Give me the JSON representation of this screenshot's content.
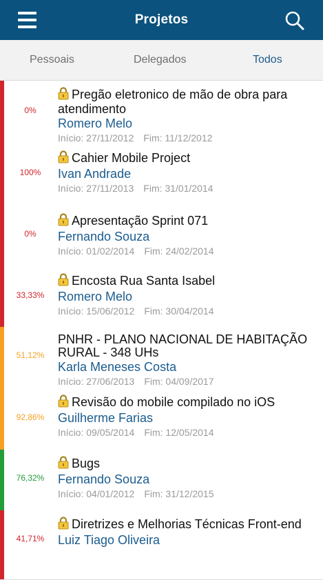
{
  "app": {
    "title": "Projetos"
  },
  "tabs": [
    {
      "label": "Pessoais"
    },
    {
      "label": "Delegados"
    },
    {
      "label": "Todos"
    }
  ],
  "colors": {
    "red": "#d0262d",
    "orange": "#f5a124",
    "green": "#259c3a",
    "header": "#0b527e"
  },
  "projects": [
    {
      "percent": "0%",
      "status": "red",
      "locked": true,
      "name": "Pregão eletronico de mão de obra para atendimento",
      "owner": "Romero Melo",
      "start": "Início: 27/11/2012",
      "end": "Fim: 11/12/2012"
    },
    {
      "percent": "100%",
      "status": "red",
      "locked": true,
      "name": "Cahier Mobile Project",
      "owner": "Ivan Andrade",
      "start": "Início: 27/11/2013",
      "end": "Fim: 31/01/2014"
    },
    {
      "percent": "0%",
      "status": "red",
      "locked": true,
      "name": "Apresentação Sprint 071",
      "owner": "Fernando Souza",
      "start": "Início: 01/02/2014",
      "end": "Fim: 24/02/2014"
    },
    {
      "percent": "33,33%",
      "status": "red",
      "locked": true,
      "name": "Encosta Rua Santa Isabel",
      "owner": "Romero Melo",
      "start": "Início: 15/06/2012",
      "end": "Fim: 30/04/2014"
    },
    {
      "percent": "51,12%",
      "status": "orange",
      "locked": false,
      "name": "PNHR - PLANO NACIONAL DE HABITAÇÃO RURAL - 348 UHs",
      "owner": "Karla Meneses Costa",
      "start": "Início: 27/06/2013",
      "end": "Fim: 04/09/2017"
    },
    {
      "percent": "92,86%",
      "status": "orange",
      "locked": true,
      "name": "Revisão do mobile compilado no iOS",
      "owner": "Guilherme Farias",
      "start": "Início: 09/05/2014",
      "end": "Fim: 12/05/2014"
    },
    {
      "percent": "76,32%",
      "status": "green",
      "locked": true,
      "name": "Bugs",
      "owner": "Fernando Souza",
      "start": "Início: 04/01/2012",
      "end": "Fim: 31/12/2015"
    },
    {
      "percent": "41,71%",
      "status": "red",
      "locked": true,
      "name": "Diretrizes e Melhorias Técnicas Front-end",
      "owner": "Luiz Tiago Oliveira",
      "start": "",
      "end": ""
    }
  ]
}
